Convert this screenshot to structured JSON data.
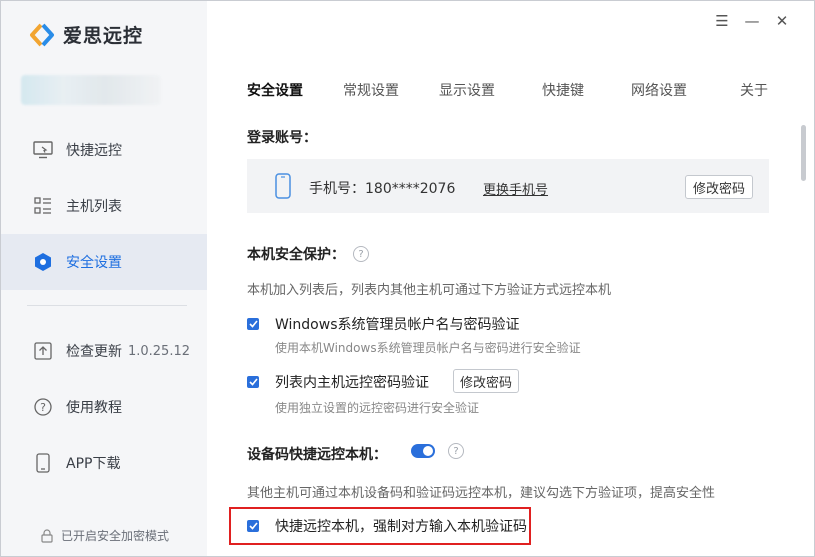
{
  "app": {
    "name": "爱思远控"
  },
  "window_controls": {
    "menu": "☰",
    "minimize": "—",
    "close": "✕"
  },
  "sidebar": {
    "items": [
      {
        "label": "快捷远控",
        "icon": "remote-screen-icon"
      },
      {
        "label": "主机列表",
        "icon": "list-icon"
      },
      {
        "label": "安全设置",
        "icon": "shield-icon",
        "active": true
      },
      {
        "label": "检查更新",
        "icon": "update-icon",
        "version": "1.0.25.12"
      },
      {
        "label": "使用教程",
        "icon": "help-circle-icon"
      },
      {
        "label": "APP下载",
        "icon": "phone-icon"
      }
    ],
    "secure_mode": "已开启安全加密模式"
  },
  "tabs": [
    "安全设置",
    "常规设置",
    "显示设置",
    "快捷键",
    "网络设置",
    "关于"
  ],
  "active_tab": "安全设置",
  "login": {
    "title": "登录账号：",
    "phone": "手机号：180****2076",
    "change_phone": "更换手机号",
    "change_password": "修改密码"
  },
  "protection": {
    "title": "本机安全保护：",
    "help": "?",
    "desc": "本机加入列表后，列表内其他主机可通过下方验证方式远控本机",
    "options": [
      {
        "label": "Windows系统管理员帐户名与密码验证",
        "sub": "使用本机Windows系统管理员帐户名与密码进行安全验证",
        "checked": true
      },
      {
        "label": "列表内主机远控密码验证",
        "sub": "使用独立设置的远控密码进行安全验证",
        "checked": true,
        "button": "修改密码"
      }
    ]
  },
  "device_code": {
    "title": "设备码快捷远控本机：",
    "enabled": true,
    "help": "?",
    "desc": "其他主机可通过本机设备码和验证码远控本机，建议勾选下方验证项，提高安全性",
    "option": {
      "label": "快捷远控本机，强制对方输入本机验证码",
      "checked": true
    }
  },
  "colors": {
    "accent": "#2a6fdb",
    "highlight_border": "#e02020",
    "sidebar_bg": "#f5f6f8"
  }
}
